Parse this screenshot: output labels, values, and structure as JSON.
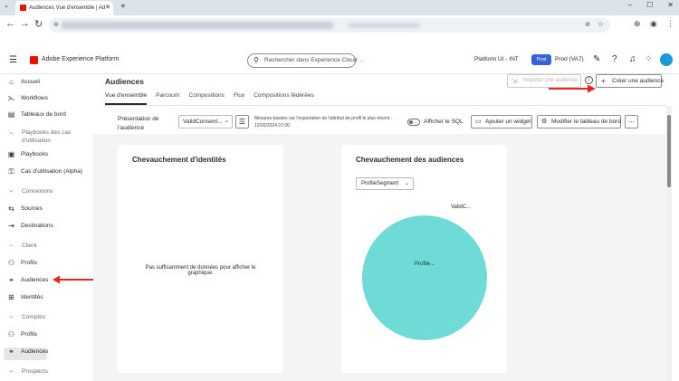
{
  "browser": {
    "tab_title": "Audiences Vue d'ensemble | Ad",
    "new_tab_label": "+"
  },
  "header": {
    "brand": "Adobe Experience Platform",
    "search_placeholder": "Rechercher dans Experience Cloud ...",
    "sandbox_label": "Platform UI - INT",
    "prod_badge": "Prod",
    "prod_name": "Prod (VA7)"
  },
  "sidebar": {
    "items": [
      {
        "label": "Accueil",
        "icon": "home-icon"
      },
      {
        "label": "Workflows",
        "icon": "workflow-icon"
      },
      {
        "label": "Tableaux de bord",
        "icon": "dashboard-icon"
      }
    ],
    "playbooks_section": "Playbooks des cas d'utilisation",
    "playbooks": "Playbooks",
    "use_cases": "Cas d'utilisation (Alpha)",
    "sections": {
      "connexions": "Connexions",
      "client": "Client",
      "comptes": "Comptes",
      "prospects": "Prospects"
    },
    "connexions_items": [
      {
        "label": "Sources"
      },
      {
        "label": "Destinations"
      }
    ],
    "client_items": [
      {
        "label": "Profils"
      },
      {
        "label": "Audiences"
      },
      {
        "label": "Identités"
      }
    ],
    "comptes_items": [
      {
        "label": "Profils"
      },
      {
        "label": "Audiences"
      }
    ]
  },
  "main": {
    "title": "Audiences",
    "import_button": "Importer une audience",
    "create_button": "Créer une audience",
    "tabs": [
      "Vue d'ensemble",
      "Parcourir",
      "Compositions",
      "Flux",
      "Compositions fédérées"
    ],
    "active_tab": "Vue d'ensemble",
    "presentation_label": "Présentation de l'audience",
    "presentation_value": "ValidConsent...",
    "measure_note": "Mesures basées sur l'exportation de l'attribut de profil le plus récent : 12/02/2024 07:00",
    "sql_toggle_label": "Afficher le SQL",
    "sql_toggle_on": false,
    "add_widget": "Ajouter un widget",
    "edit_dashboard": "Modifier le tableau de bord"
  },
  "cards": {
    "identity_overlap": {
      "title": "Chevauchement d'identités",
      "empty_message": "Pas suffisamment de données pour afficher le graphique."
    },
    "audience_overlap": {
      "title": "Chevauchement des audiences",
      "dropdown": "ProfileSegment",
      "circle_label": "Profile...",
      "outer_label": "ValidC...",
      "circle_color": "#6fdbd6"
    }
  },
  "colors": {
    "accent_blue": "#3562d6",
    "adobe_red": "#eb1000",
    "annotation_arrow": "#e8261c"
  }
}
